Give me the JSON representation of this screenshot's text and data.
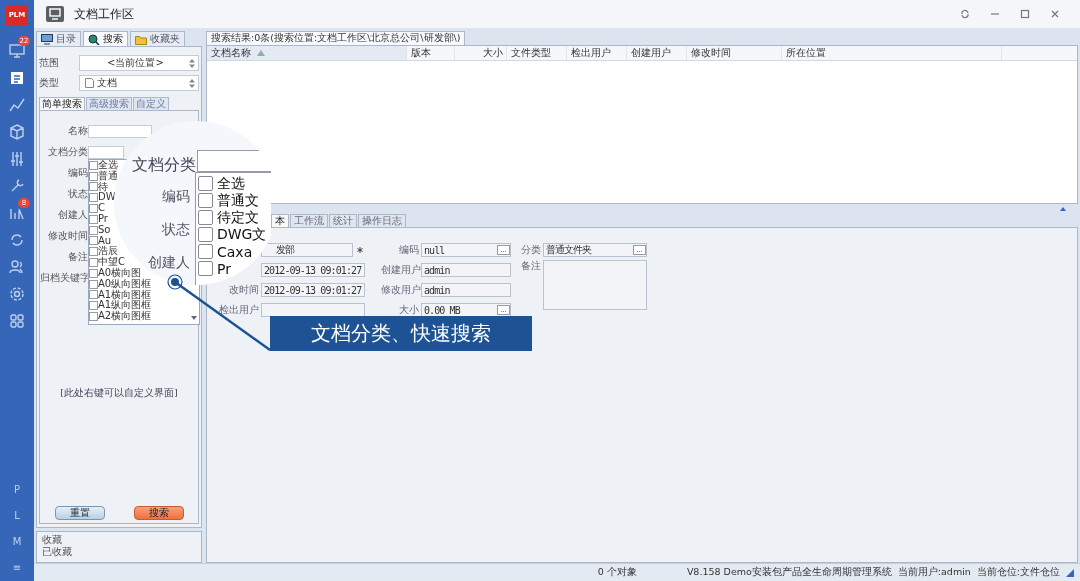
{
  "window": {
    "title": "文档工作区"
  },
  "rail": {
    "logo": "PLM",
    "items": [
      {
        "selected": false,
        "badge": "22"
      },
      {
        "selected": true
      },
      {
        "selected": false
      },
      {
        "selected": false
      },
      {
        "selected": false
      },
      {
        "selected": false
      },
      {
        "selected": false,
        "badge": "8"
      },
      {
        "selected": false
      },
      {
        "selected": false
      },
      {
        "selected": false
      },
      {
        "selected": false
      }
    ],
    "letters": [
      "P",
      "L",
      "M",
      "≡"
    ]
  },
  "left_panel": {
    "tabs": [
      {
        "label": "目录",
        "selected": false
      },
      {
        "label": "搜索",
        "selected": true
      },
      {
        "label": "收藏夹",
        "selected": false
      }
    ],
    "scope": {
      "label": "范围",
      "value": "<当前位置>"
    },
    "type": {
      "label": "类型",
      "value": "文档"
    },
    "search_tabs": [
      {
        "label": "简单搜索",
        "selected": true
      },
      {
        "label": "高级搜索",
        "selected": false
      },
      {
        "label": "自定义",
        "selected": false
      }
    ],
    "fields": [
      {
        "label": "名称",
        "kind": "input"
      },
      {
        "label": "文档分类",
        "kind": "input"
      },
      {
        "label": "编码",
        "kind": "label"
      },
      {
        "label": "状态",
        "kind": "label"
      },
      {
        "label": "创建人",
        "kind": "label"
      },
      {
        "label": "修改时间",
        "kind": "label"
      },
      {
        "label": "备注",
        "kind": "label"
      },
      {
        "label": "归档关键字",
        "kind": "label"
      }
    ],
    "category_list": [
      {
        "label": "全选",
        "checked": false
      },
      {
        "label": "普通",
        "checked": false
      },
      {
        "label": "待",
        "checked": false
      },
      {
        "label": "DW",
        "checked": false
      },
      {
        "label": "C",
        "checked": false
      },
      {
        "label": "Pr",
        "checked": false
      },
      {
        "label": "So",
        "checked": false
      },
      {
        "label": "Au",
        "checked": false
      },
      {
        "label": "浩辰",
        "checked": false
      },
      {
        "label": "中望C",
        "checked": false
      },
      {
        "label": "A0横向图",
        "checked": false
      },
      {
        "label": "A0纵向图框",
        "checked": false
      },
      {
        "label": "A1横向图框",
        "checked": false
      },
      {
        "label": "A1纵向图框",
        "checked": false
      },
      {
        "label": "A2横向图框",
        "checked": false
      }
    ],
    "hint": "[此处右键可以自定义界面]",
    "buttons": [
      {
        "label": "重置",
        "kind": "default"
      },
      {
        "label": "搜索",
        "kind": "primary"
      }
    ],
    "favorites": [
      "收藏",
      "已收藏"
    ]
  },
  "results": {
    "tab": "搜索结果:0条(搜索位置:文档工作区\\北京总公司\\研发部\\)",
    "columns": [
      {
        "label": "文档名称",
        "sorted": true
      },
      {
        "label": "版本",
        "sorted": false
      },
      {
        "label": "大小",
        "sorted": false
      },
      {
        "label": "文件类型",
        "sorted": false
      },
      {
        "label": "检出用户",
        "sorted": false
      },
      {
        "label": "创建用户",
        "sorted": false
      },
      {
        "label": "修改时间",
        "sorted": false
      },
      {
        "label": "所在位置",
        "sorted": false
      }
    ]
  },
  "details": {
    "tabs": [
      {
        "label": "本",
        "selected": true
      },
      {
        "label": "工作流",
        "selected": false
      },
      {
        "label": "统计",
        "selected": false
      },
      {
        "label": "操作日志",
        "selected": false
      }
    ],
    "columns": [
      [
        {
          "value": "发部",
          "required": true
        },
        {
          "value": "2012-09-13 09:01:27"
        },
        {
          "label": "改时间",
          "value": "2012-09-13 09:01:27"
        },
        {
          "label": "检出用户"
        }
      ],
      [
        {
          "label": "编码",
          "value": "null",
          "button": "..."
        },
        {
          "label": "创建用户",
          "value": "admin"
        },
        {
          "label": "修改用户",
          "value": "admin"
        },
        {
          "label": "大小",
          "value": "0.00 MB",
          "button": "..."
        }
      ],
      [
        {
          "label": "分类",
          "value": "普通文件夹",
          "button": "..."
        },
        {
          "label": "备注",
          "kind": "textarea"
        }
      ]
    ]
  },
  "magnifier": {
    "field_label": "文档分类",
    "labels": [
      "编码",
      "状态",
      "创建人"
    ],
    "items": [
      {
        "label": "全选",
        "checked": false
      },
      {
        "label": "普通文",
        "checked": false
      },
      {
        "label": "待定文",
        "checked": false
      },
      {
        "label": "DWG文",
        "checked": false
      },
      {
        "label": "Caxa",
        "checked": false
      },
      {
        "label": "Pr",
        "checked": false
      }
    ]
  },
  "callout": "文档分类、快速搜索",
  "status_bar": [
    "0 个对象",
    "V8.158 Demo安装包产品全生命周期管理系统",
    "当前用户:admin",
    "当前仓位:文件仓位"
  ]
}
